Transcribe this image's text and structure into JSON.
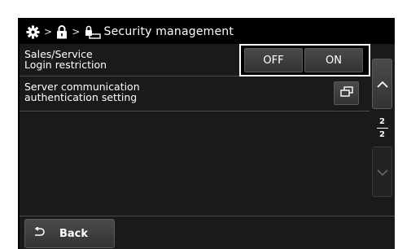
{
  "header": {
    "separator": ">",
    "title": "Security management"
  },
  "rows": [
    {
      "label_line1": "Sales/Service",
      "label_line2": "Login restriction",
      "toggle": {
        "off_label": "OFF",
        "on_label": "ON"
      }
    },
    {
      "label_line1": "Server communication",
      "label_line2": "authentication setting"
    }
  ],
  "pager": {
    "current": "2",
    "total": "2"
  },
  "footer": {
    "back_label": "Back"
  },
  "icons": {
    "gear": "gear-icon",
    "lock": "lock-icon",
    "lock_key": "lock-key-icon",
    "open_window": "window-icon",
    "up": "chevron-up-icon",
    "down": "chevron-down-icon",
    "back": "return-arrow-icon"
  }
}
